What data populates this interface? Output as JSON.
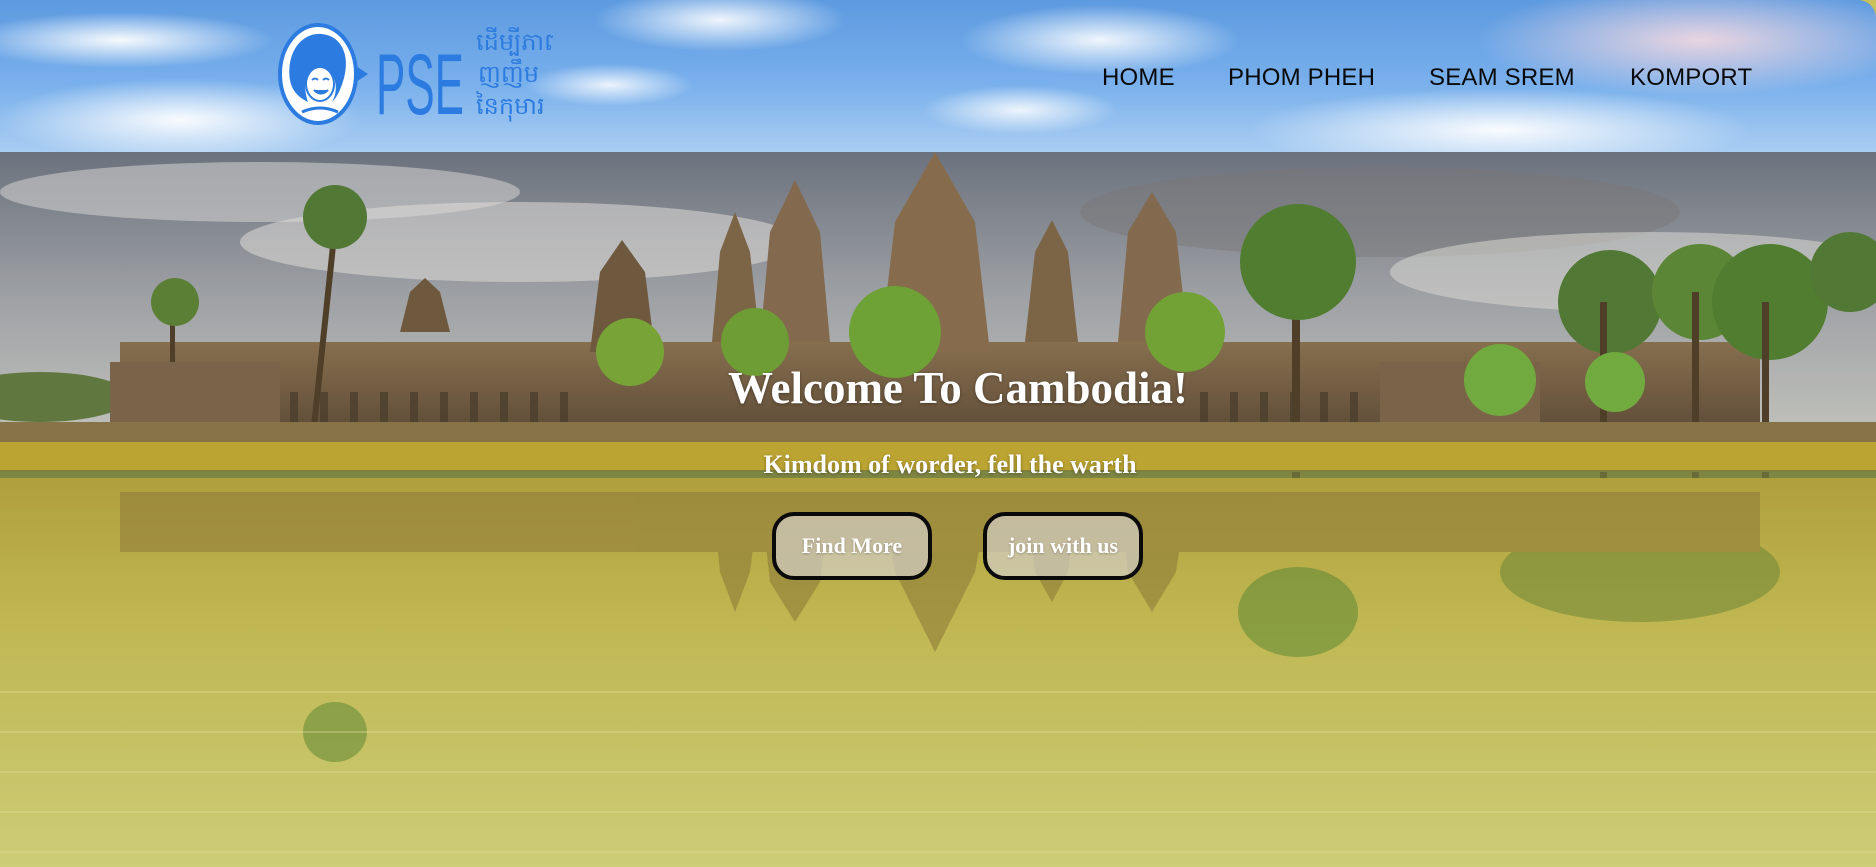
{
  "header": {
    "logo": {
      "brand_text": "PSE",
      "tagline_lines": [
        "ដើម្បីភាព",
        "ញញឹម",
        "នៃកុមារ"
      ]
    },
    "nav": [
      {
        "label": "HOME"
      },
      {
        "label": "PHOM PHEH"
      },
      {
        "label": "SEAM SREM"
      },
      {
        "label": "KOMPORT"
      }
    ]
  },
  "hero": {
    "title": "Welcome To Cambodia!",
    "subtitle": "Kimdom of worder, fell the warth",
    "buttons": {
      "find_more": "Find More",
      "join": "join with us"
    }
  },
  "colors": {
    "logo_blue": "#2b7be0",
    "nav_text": "#0a0a0a",
    "hero_text": "#ffffff",
    "button_border": "#0a0a0a"
  }
}
